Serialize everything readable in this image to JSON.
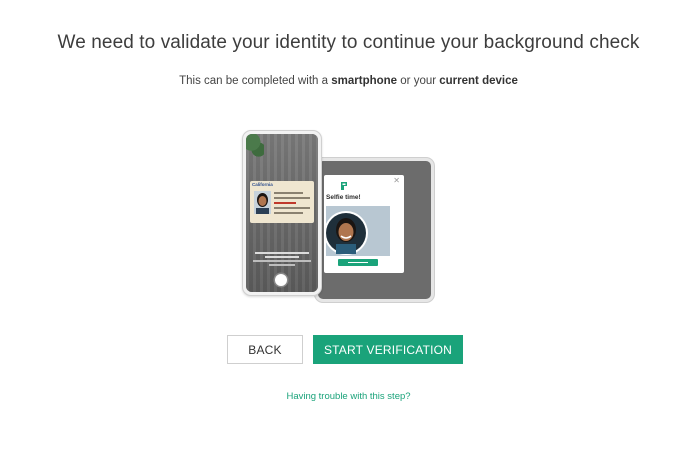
{
  "page": {
    "title": "We need to validate your identity to continue your background check",
    "subtitle_prefix": "This can be completed with a ",
    "subtitle_bold1": "smartphone",
    "subtitle_middle": " or your ",
    "subtitle_bold2": "current device"
  },
  "illustration": {
    "selfie_title": "Selfie time!",
    "id_card_header": "California",
    "close_icon": "close-icon"
  },
  "actions": {
    "back_label": "BACK",
    "start_label": "START VERIFICATION",
    "help_link": "Having trouble with this step?"
  },
  "colors": {
    "accent": "#1aa37a",
    "text": "#3d3d3d"
  }
}
